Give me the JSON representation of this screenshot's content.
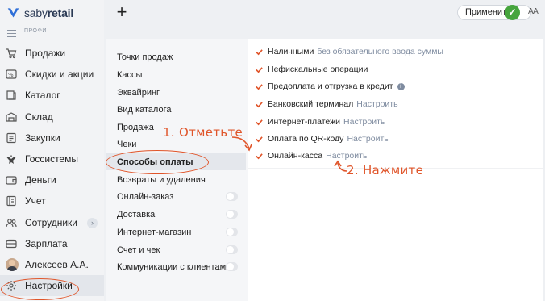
{
  "brand": {
    "name_regular": "saby",
    "name_bold": "retail",
    "tier": "ПРОФИ"
  },
  "sidebar": {
    "items": [
      {
        "label": "Продажи",
        "icon": "cart-icon"
      },
      {
        "label": "Скидки и акции",
        "icon": "percent-icon"
      },
      {
        "label": "Каталог",
        "icon": "catalog-icon"
      },
      {
        "label": "Склад",
        "icon": "warehouse-icon"
      },
      {
        "label": "Закупки",
        "icon": "purchases-icon"
      },
      {
        "label": "Госсистемы",
        "icon": "eagle-icon"
      },
      {
        "label": "Деньги",
        "icon": "wallet-icon"
      },
      {
        "label": "Учет",
        "icon": "ledger-icon"
      },
      {
        "label": "Сотрудники",
        "icon": "people-icon"
      },
      {
        "label": "Зарплата",
        "icon": "salary-icon"
      },
      {
        "label": "Алексеев А.А.",
        "icon": "avatar"
      },
      {
        "label": "Настройки",
        "icon": "gear-icon"
      }
    ],
    "expand_chevron": "›"
  },
  "toolbar": {
    "add": "+",
    "apply_label": "Применить",
    "font_size_label": "AA"
  },
  "settings_menu": {
    "items": [
      {
        "label": "Точки продаж"
      },
      {
        "label": "Кассы"
      },
      {
        "label": "Эквайринг"
      },
      {
        "label": "Вид каталога"
      },
      {
        "label": "Продажа"
      },
      {
        "label": "Чеки"
      },
      {
        "label": "Способы оплаты"
      },
      {
        "label": "Возвраты и удаления"
      },
      {
        "label": "Онлайн-заказ"
      },
      {
        "label": "Доставка"
      },
      {
        "label": "Интернет-магазин"
      },
      {
        "label": "Счет и чек"
      },
      {
        "label": "Коммуникации с клиентами"
      }
    ]
  },
  "payment_options": [
    {
      "label": "Наличными",
      "link": "без обязательного ввода суммы",
      "checked": true
    },
    {
      "label": "Нефискальные операции",
      "link": "",
      "checked": true
    },
    {
      "label": "Предоплата и отгрузка в кредит",
      "link": "",
      "checked": true,
      "info_icon": "i"
    },
    {
      "label": "Банковский терминал",
      "link": "Настроить",
      "checked": true
    },
    {
      "label": "Интернет-платежи",
      "link": "Настроить",
      "checked": true
    },
    {
      "label": "Оплата по QR-коду",
      "link": "Настроить",
      "checked": true
    },
    {
      "label": "Онлайн-касса",
      "link": "Настроить",
      "checked": true
    }
  ],
  "annotations": {
    "step1": "1. Отметьте",
    "step2": "2. Нажмите"
  },
  "colors": {
    "accent": "#e0552a",
    "link": "#7f8ca0",
    "apply_check": "#46a53d"
  }
}
